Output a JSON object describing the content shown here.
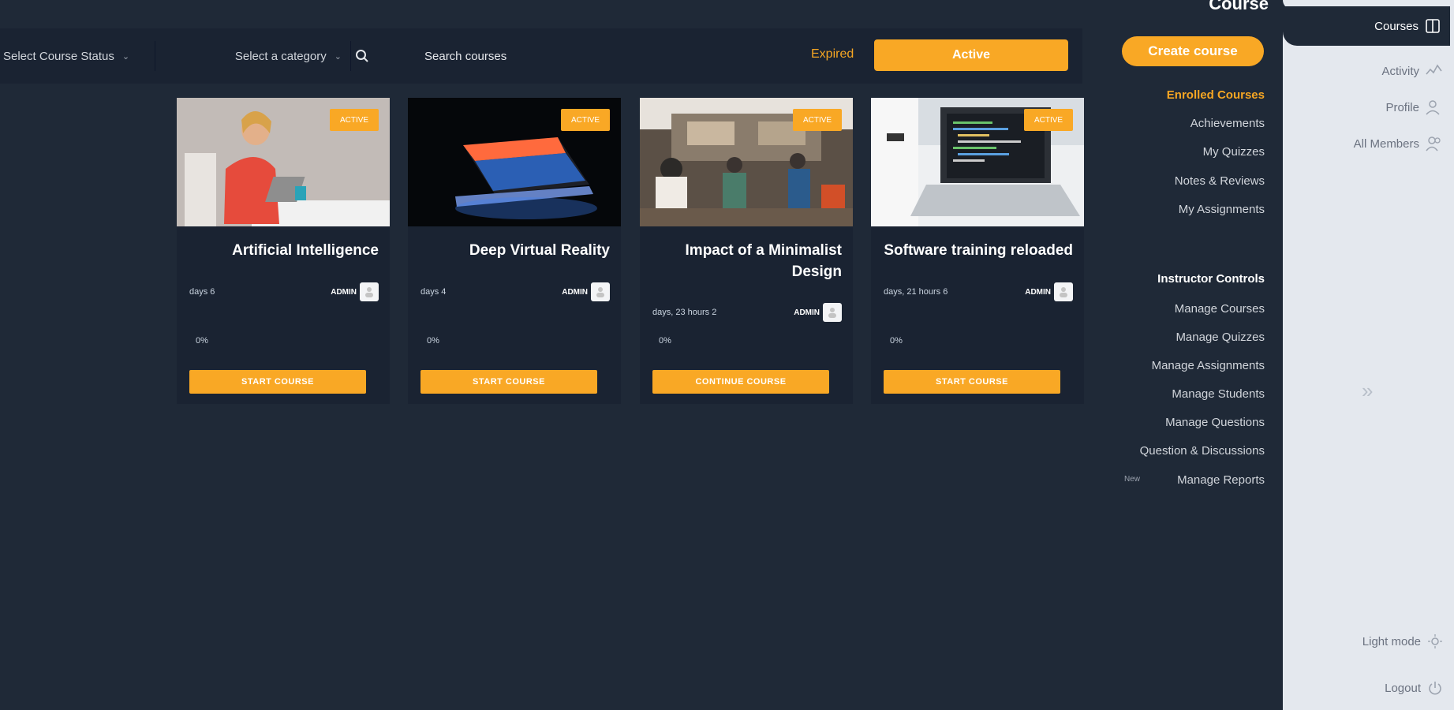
{
  "filters": {
    "status_label": "Select Course Status",
    "category_label": "Select a category",
    "search_placeholder": "Search courses",
    "expired_label": "Expired",
    "active_label": "Active"
  },
  "courses": [
    {
      "badge": "ACTIVE",
      "title": "Artificial Intelligence",
      "duration": "days 6",
      "author": "ADMIN",
      "progress": "0%",
      "cta": "START COURSE"
    },
    {
      "badge": "ACTIVE",
      "title": "Deep Virtual Reality",
      "duration": "days 4",
      "author": "ADMIN",
      "progress": "0%",
      "cta": "START COURSE"
    },
    {
      "badge": "ACTIVE",
      "title": "Impact of a Minimalist Design",
      "duration": "days, 23 hours 2",
      "author": "ADMIN",
      "progress": "0%",
      "cta": "CONTINUE COURSE"
    },
    {
      "badge": "ACTIVE",
      "title": "Software training reloaded",
      "duration": "days, 21 hours 6",
      "author": "ADMIN",
      "progress": "0%",
      "cta": "START COURSE"
    }
  ],
  "nav": {
    "heading": "Course",
    "create_label": "Create course",
    "items": [
      "Enrolled Courses",
      "Achievements",
      "My Quizzes",
      "Notes & Reviews",
      "My Assignments"
    ],
    "instructor_heading": "Instructor Controls",
    "instructor_items": [
      "Manage Courses",
      "Manage Quizzes",
      "Manage Assignments",
      "Manage Students",
      "Manage Questions",
      "Question & Discussions",
      "Manage Reports"
    ],
    "new_tag": "New"
  },
  "right_panel": {
    "courses_label": "Courses",
    "items": [
      "Activity",
      "Profile",
      "All Members"
    ],
    "light_mode_label": "Light mode",
    "logout_label": "Logout"
  },
  "colors": {
    "background": "#1f2937",
    "card": "#1a2332",
    "accent": "#f9a825",
    "panel": "#e4e8ee"
  }
}
